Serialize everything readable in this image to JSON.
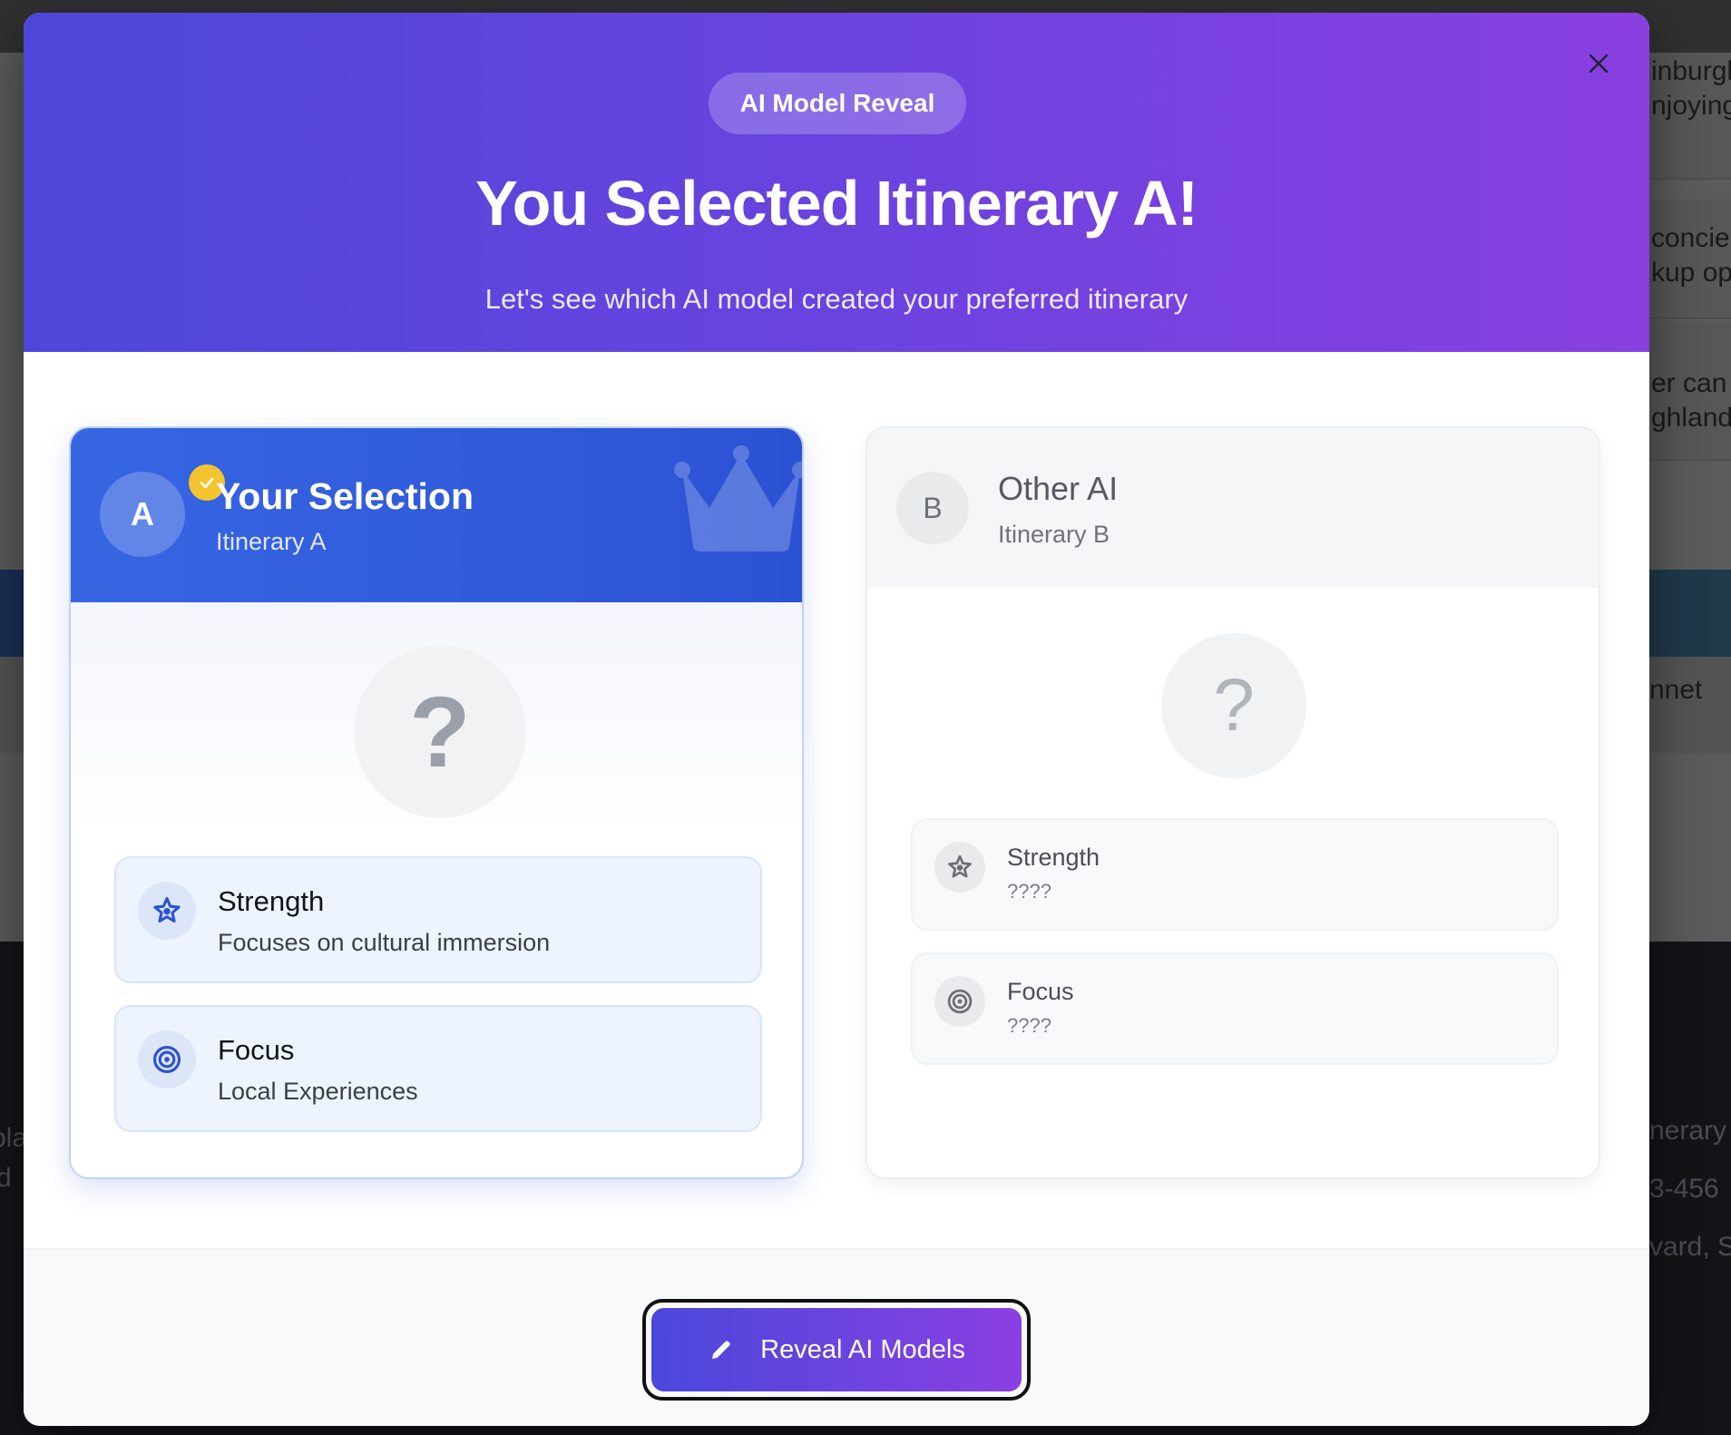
{
  "background": {
    "right_snippets": [
      "inburgh",
      "njoying",
      "concie",
      "kup op",
      "er can",
      "ghlands",
      "nnet",
      "nerary",
      "3-456",
      "vard, S"
    ],
    "left_snippets": [
      "pla",
      "d"
    ]
  },
  "modal": {
    "pill": "AI Model Reveal",
    "title": "You Selected Itinerary A!",
    "subtitle": "Let's see which AI model created your preferred itinerary",
    "close_icon": "close-icon"
  },
  "cards": [
    {
      "badge": "A",
      "title": "Your Selection",
      "subtitle": "Itinerary A",
      "question": "?",
      "strength_label": "Strength",
      "strength_value": "Focuses on cultural immersion",
      "focus_label": "Focus",
      "focus_value": "Local Experiences",
      "accent": "#2c52d4"
    },
    {
      "badge": "B",
      "title": "Other AI",
      "subtitle": "Itinerary B",
      "question": "?",
      "strength_label": "Strength",
      "strength_value": "????",
      "focus_label": "Focus",
      "focus_value": "????",
      "accent": "#6b6f76"
    }
  ],
  "footer": {
    "reveal_label": "Reveal AI Models"
  },
  "colors": {
    "header_start": "#4d47d9",
    "header_end": "#8a3fe0",
    "check": "#f4c430"
  }
}
